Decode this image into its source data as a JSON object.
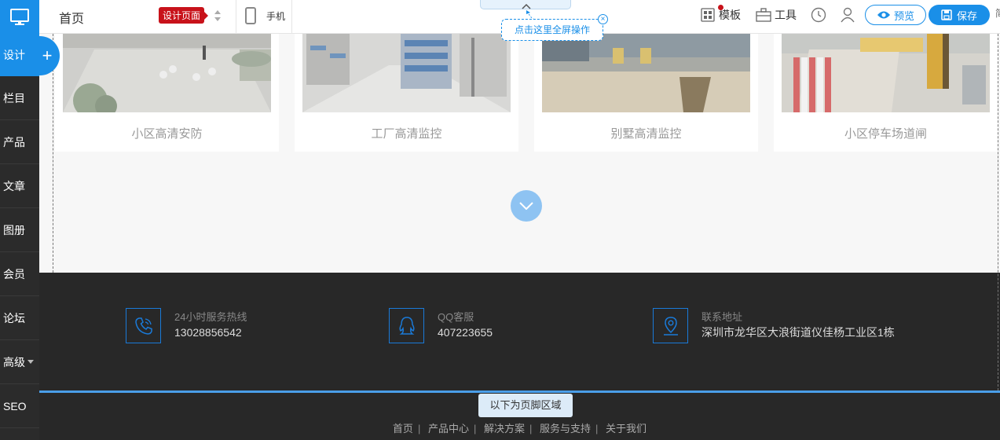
{
  "sidebar": {
    "items": [
      {
        "label": "设计",
        "active": true
      },
      {
        "label": "栏目"
      },
      {
        "label": "产品"
      },
      {
        "label": "文章"
      },
      {
        "label": "图册"
      },
      {
        "label": "会员"
      },
      {
        "label": "论坛"
      },
      {
        "label": "高级"
      },
      {
        "label": "SEO"
      }
    ],
    "add_label": "+"
  },
  "toolbar": {
    "page_name": "首页",
    "design_badge": "设计页面",
    "mobile_label": "手机",
    "fullscreen_tip": "点击这里全屏操作",
    "template_label": "模板",
    "tools_label": "工具",
    "preview_label": "预览",
    "save_label": "保存",
    "more_label": "简"
  },
  "cards": [
    {
      "caption": "小区高清安防"
    },
    {
      "caption": "工厂高清监控"
    },
    {
      "caption": "别墅高清监控"
    },
    {
      "caption": "小区停车场道闸"
    }
  ],
  "contact": [
    {
      "icon": "phone-icon",
      "label": "24小时服务热线",
      "value": "13028856542"
    },
    {
      "icon": "qq-icon",
      "label": "QQ客服",
      "value": "407223655"
    },
    {
      "icon": "location-icon",
      "label": "联系地址",
      "value": "深圳市龙华区大浪街道仪佳杨工业区1栋"
    }
  ],
  "footer": {
    "tip": "以下为页脚区域",
    "links": [
      "首页",
      "产品中心",
      "解决方案",
      "服务与支持",
      "关于我们"
    ]
  },
  "colors": {
    "accent": "#1a8fe8",
    "badge": "#c8121a",
    "dark": "#282828"
  }
}
